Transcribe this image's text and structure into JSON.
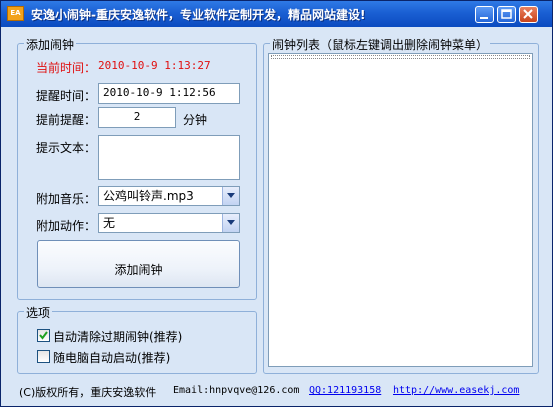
{
  "window": {
    "title": "安逸小闹钟-重庆安逸软件，专业软件定制开发，精品网站建设!",
    "icon_name": "clock-app-icon",
    "icon_text": "EA"
  },
  "add_alarm": {
    "legend": "添加闹钟",
    "current_time_label": "当前时间：",
    "current_time_value": "2010-10-9 1:13:27",
    "remind_time_label": "提醒时间：",
    "remind_time_value": "2010-10-9 1:12:56",
    "advance_label": "提前提醒：",
    "advance_value": "2",
    "advance_unit": "分钟",
    "text_label": "提示文本：",
    "text_value": "",
    "music_label": "附加音乐：",
    "music_value": "公鸡叫铃声.mp3",
    "action_label": "附加动作：",
    "action_value": "无",
    "add_button": "添加闹钟"
  },
  "alarm_list": {
    "legend": "闹钟列表（鼠标左键调出删除闹钟菜单）"
  },
  "options": {
    "legend": "选项",
    "auto_clear_label": "自动清除过期闹钟(推荐)",
    "auto_clear_checked": true,
    "autostart_label": "随电脑自动启动(推荐)",
    "autostart_checked": false
  },
  "footer": {
    "copyright": "(C)版权所有，重庆安逸软件",
    "email": "Email:hnpvqve@126.com",
    "qq": "QQ:121193158",
    "website": "http://www.easekj.com"
  }
}
